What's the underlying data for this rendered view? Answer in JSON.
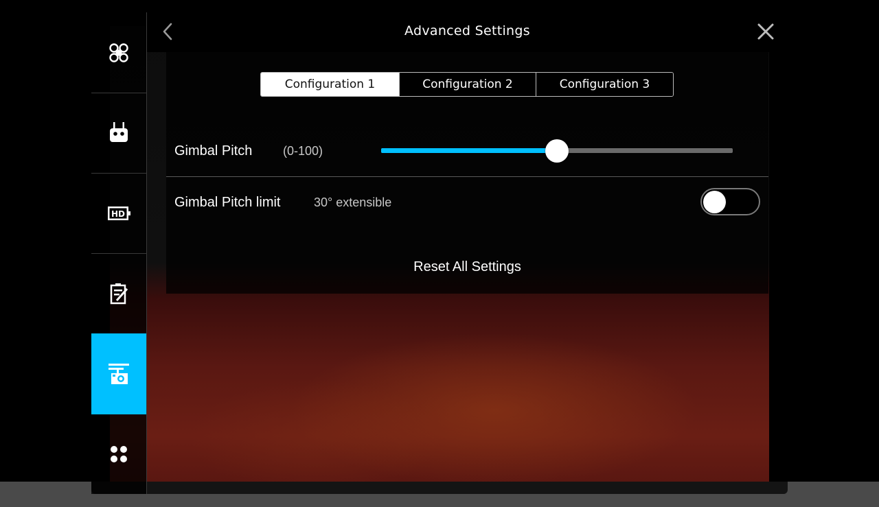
{
  "header": {
    "title": "Advanced Settings"
  },
  "sidebar": {
    "items": [
      {
        "icon": "aircraft-icon",
        "active": false
      },
      {
        "icon": "remote-controller-icon",
        "active": false
      },
      {
        "icon": "hd-transmission-icon",
        "active": false
      },
      {
        "icon": "checklist-icon",
        "active": false
      },
      {
        "icon": "gimbal-camera-icon",
        "active": true
      },
      {
        "icon": "more-grid-icon",
        "active": false
      }
    ]
  },
  "configurations": {
    "tabs": [
      "Configuration 1",
      "Configuration 2",
      "Configuration 3"
    ],
    "selected": "Configuration 1"
  },
  "gimbal_pitch": {
    "label": "Gimbal Pitch",
    "range": "(0-100)",
    "value": 50
  },
  "gimbal_pitch_limit": {
    "label": "Gimbal Pitch limit",
    "description": "30° extensible",
    "enabled": false
  },
  "reset_label": "Reset All Settings",
  "colors": {
    "accent": "#00c0ff",
    "background": "#000000",
    "text": "#ffffff"
  }
}
